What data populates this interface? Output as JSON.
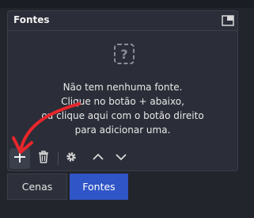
{
  "dock": {
    "title": "Fontes"
  },
  "empty_state": {
    "line1": "Não tem nenhuma fonte.",
    "line2": "Clique no botão + abaixo,",
    "line3": "ou clique aqui com o botão direito",
    "line4": "para adicionar uma."
  },
  "toolbar": {
    "icons": [
      "plus-icon",
      "trash-icon",
      "gear-icon",
      "chevron-up-icon",
      "chevron-down-icon"
    ]
  },
  "tabs": [
    {
      "label": "Cenas",
      "active": false
    },
    {
      "label": "Fontes",
      "active": true
    }
  ],
  "colors": {
    "accent": "#2f55c6",
    "annotation_arrow": "#e8262b"
  }
}
